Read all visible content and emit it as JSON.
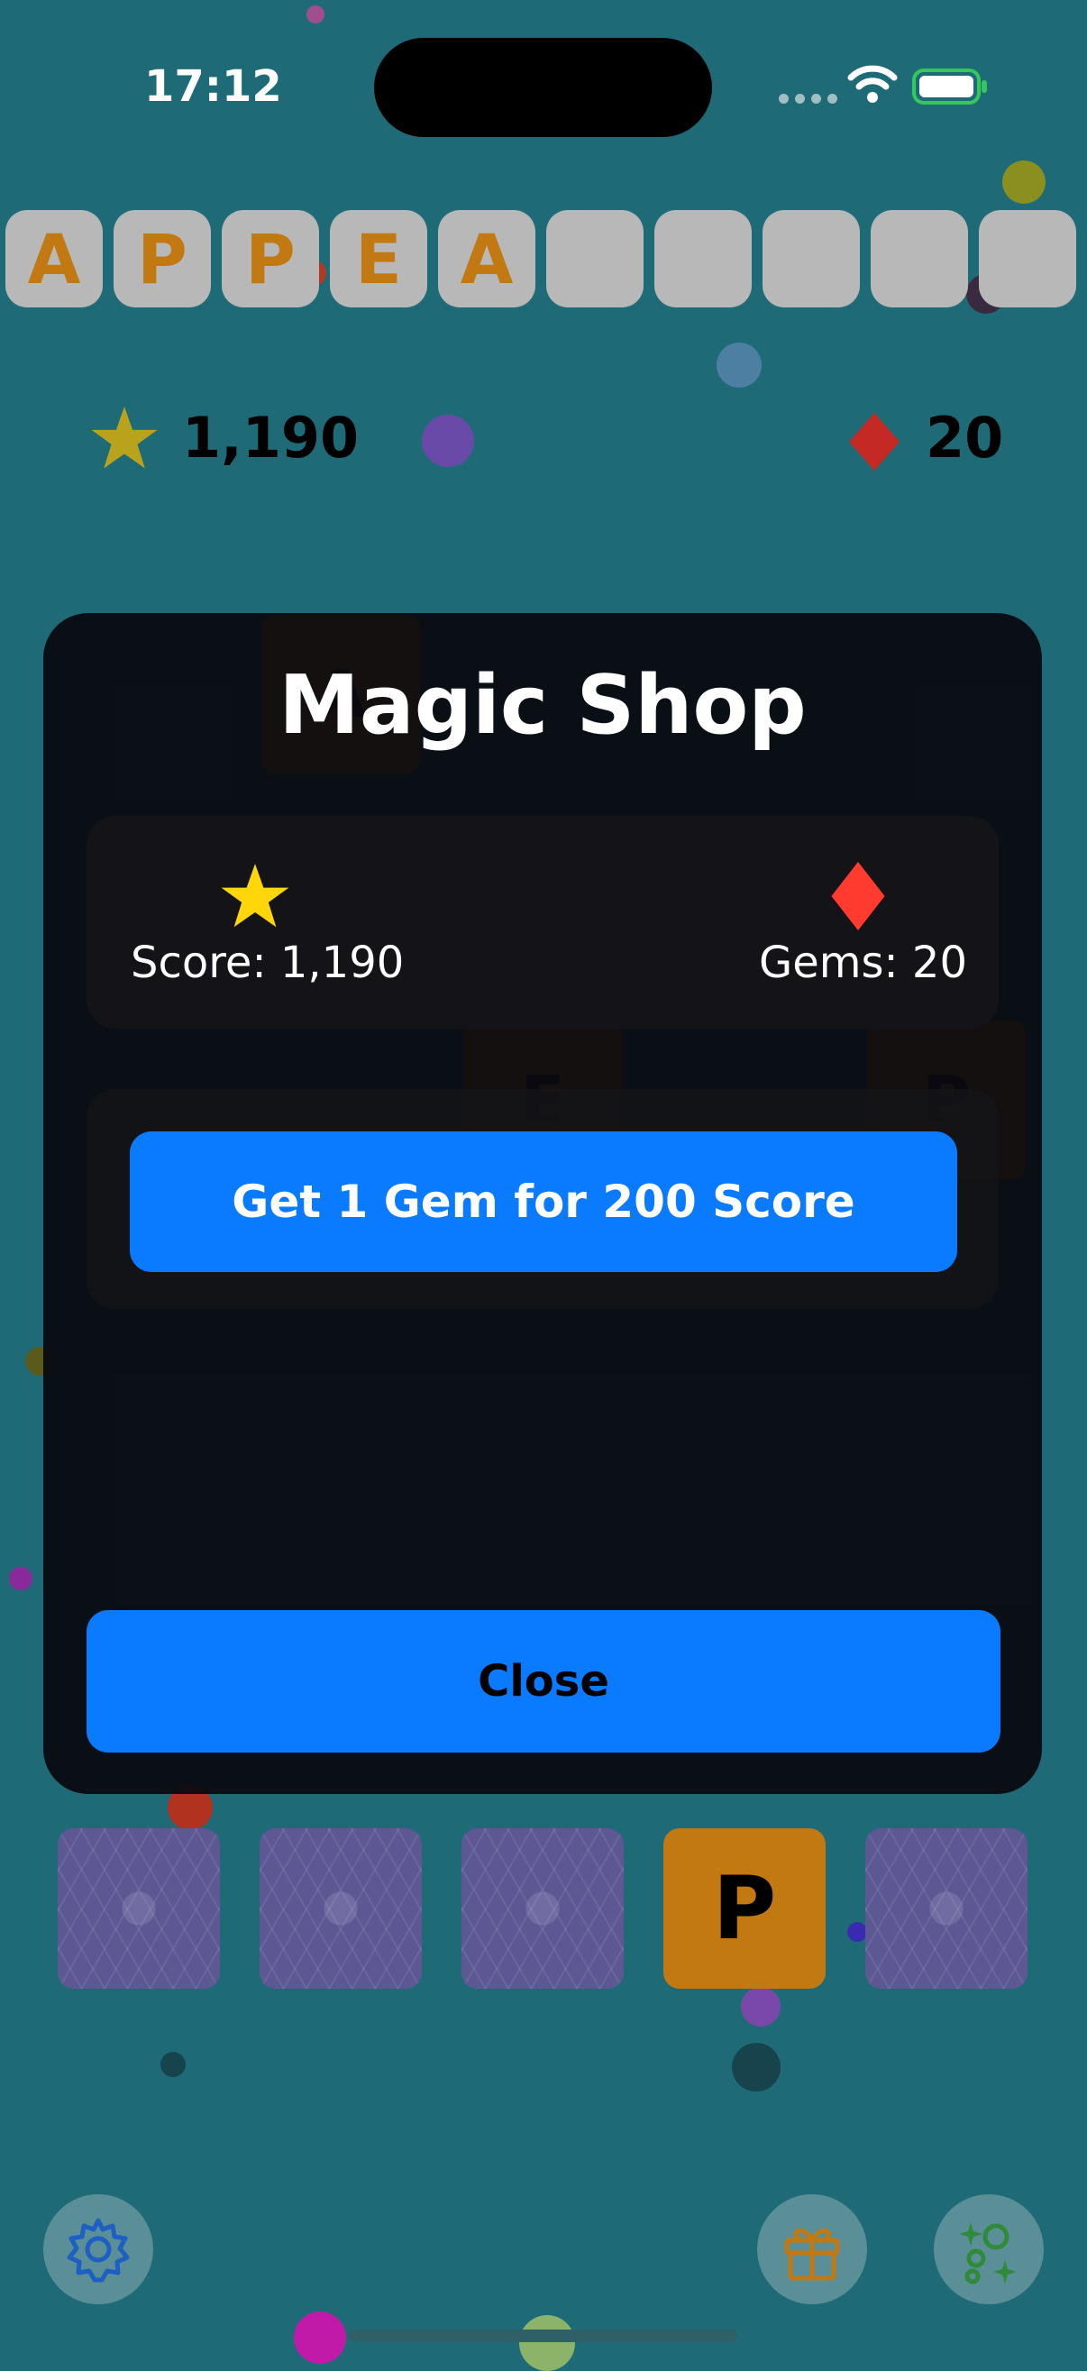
{
  "status_bar": {
    "time": "17:12"
  },
  "word_tiles": [
    "A",
    "P",
    "P",
    "E",
    "A",
    "",
    "",
    "",
    "",
    ""
  ],
  "header": {
    "score": "1,190",
    "gems": "20"
  },
  "background_board": {
    "letters": [
      "A",
      "E",
      "P"
    ]
  },
  "modal": {
    "title": "Magic Shop",
    "score_label": "Score: 1,190",
    "gems_label": "Gems: 20",
    "buy_button": "Get 1 Gem for 200 Score",
    "close_button": "Close"
  },
  "rack": {
    "tiles": [
      {
        "letter": "",
        "state": "hidden"
      },
      {
        "letter": "",
        "state": "hidden"
      },
      {
        "letter": "",
        "state": "hidden"
      },
      {
        "letter": "P",
        "state": "revealed"
      },
      {
        "letter": "",
        "state": "hidden"
      }
    ]
  },
  "icons": {
    "score": "star-icon",
    "gems": "diamond-icon",
    "settings": "gear-icon",
    "gift": "gift-icon",
    "bubbles": "bubbles-sparkle-icon"
  },
  "colors": {
    "background": "#1e6b77",
    "accent": "#0a7afe",
    "tile_letter": "#c27912",
    "star": "#ffd60a",
    "gem": "#ff3b30",
    "modal": "#0a0a10"
  }
}
